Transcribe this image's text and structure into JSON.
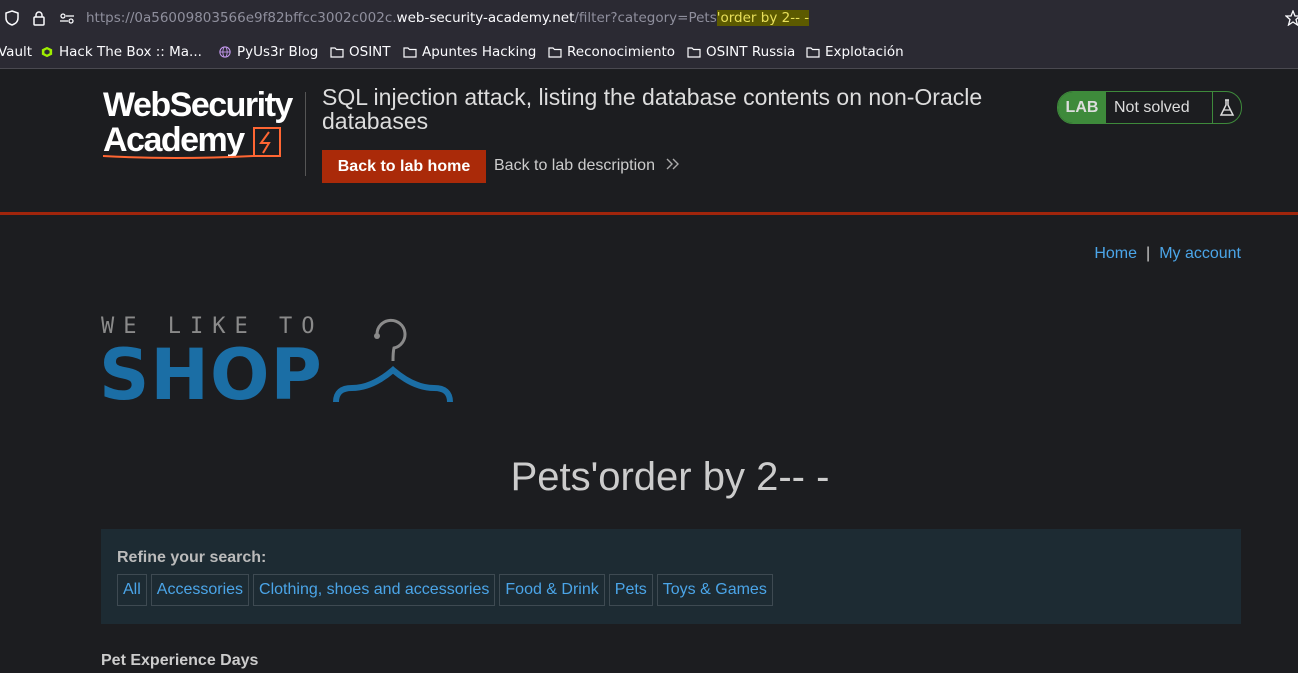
{
  "browser": {
    "url_prefix": "https://0a56009803566e9f82bffcc3002c002c.",
    "url_host": "web-security-academy.net",
    "url_path": "/filter?category=Pets",
    "url_highlight": "'order by 2-- -",
    "bookmarks": [
      {
        "label": "Vault",
        "icon": "none"
      },
      {
        "label": "Hack The Box :: Ma...",
        "icon": "htb-icon"
      },
      {
        "label": "PyUs3r Blog",
        "icon": "globe-icon"
      },
      {
        "label": "OSINT",
        "icon": "folder-icon"
      },
      {
        "label": "Apuntes Hacking",
        "icon": "folder-icon"
      },
      {
        "label": "Reconocimiento",
        "icon": "folder-icon"
      },
      {
        "label": "OSINT Russia",
        "icon": "folder-icon"
      },
      {
        "label": "Explotación",
        "icon": "folder-icon"
      }
    ]
  },
  "lab": {
    "logo_line1": "WebSecurity",
    "logo_line2": "Academy",
    "title": "SQL injection attack, listing the database contents on non-Oracle databases",
    "back_button": "Back to lab home",
    "desc_link": "Back to lab description",
    "status_badge": "LAB",
    "status_text": "Not solved",
    "colors": {
      "accent": "#aa2a09",
      "solved_green": "#3e8a3b"
    }
  },
  "nav": {
    "home": "Home",
    "separator": "|",
    "account": "My account"
  },
  "shop": {
    "tagline": "WE LIKE TO",
    "name": "SHOP"
  },
  "page": {
    "title": "Pets'order by 2-- -",
    "refine_label": "Refine your search:",
    "categories": [
      "All",
      "Accessories",
      "Clothing, shoes and accessories",
      "Food & Drink",
      "Pets",
      "Toys & Games"
    ],
    "first_product": "Pet Experience Days"
  }
}
